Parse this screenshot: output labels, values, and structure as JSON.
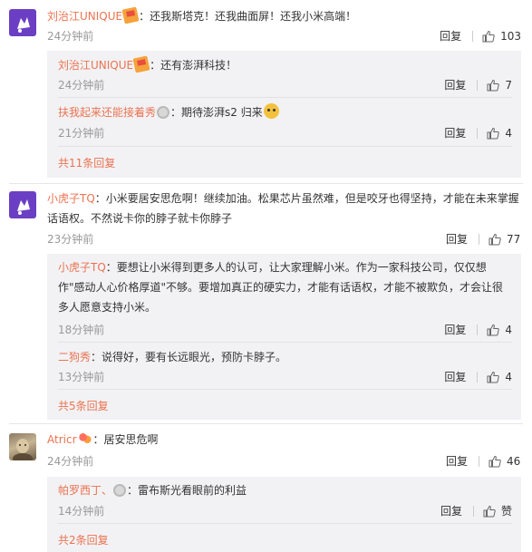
{
  "comments": [
    {
      "user": "刘治江UNIQUE",
      "text": "：还我斯塔克！还我曲面屏！还我小米高端！",
      "time": "24分钟前",
      "reply_label": "回复",
      "likes": "103",
      "replies": [
        {
          "user": "刘治江UNIQUE",
          "text": "：还有澎湃科技！",
          "time": "24分钟前",
          "reply_label": "回复",
          "likes": "7"
        },
        {
          "user": "扶我起来还能接着秀",
          "text": "：期待澎湃s2 归来",
          "time": "21分钟前",
          "reply_label": "回复",
          "likes": "4"
        }
      ],
      "more": "共11条回复"
    },
    {
      "user": "小虎子TQ",
      "text": "：小米要居安思危啊！继续加油。松果芯片虽然难，但是咬牙也得坚持，才能在未来掌握话语权。不然说卡你的脖子就卡你脖子",
      "time": "23分钟前",
      "reply_label": "回复",
      "likes": "77",
      "replies": [
        {
          "user": "小虎子TQ",
          "text": "：要想让小米得到更多人的认可，让大家理解小米。作为一家科技公司，仅仅想作\"感动人心价格厚道\"不够。要增加真正的硬实力，才能有话语权，才能不被欺负，才会让很多人愿意支持小米。",
          "time": "18分钟前",
          "reply_label": "回复",
          "likes": "4"
        },
        {
          "user": "二狗秀",
          "text": "：说得好，要有长远眼光，预防卡脖子。",
          "time": "13分钟前",
          "reply_label": "回复",
          "likes": "4"
        }
      ],
      "more": "共5条回复"
    },
    {
      "user": "Atricr",
      "text": "：居安思危啊",
      "time": "24分钟前",
      "reply_label": "回复",
      "likes": "46",
      "replies": [
        {
          "user": "帕罗西丁、",
          "text": "：雷布斯光看眼前的利益",
          "time": "14分钟前",
          "reply_label": "回复",
          "likes": "赞"
        }
      ],
      "more": "共2条回复"
    }
  ],
  "icons": {
    "like": "thumbs-up-icon",
    "flag_emoji": "flag-emoji-icon",
    "medal_badge": "medal-badge-icon",
    "cat_emoji": "cat-face-emoji-icon",
    "hearts_emoji": "hearts-emoji-icon"
  },
  "colors": {
    "username": "#eb7350",
    "reply_bg": "#f2f2f5",
    "time": "#999999"
  }
}
